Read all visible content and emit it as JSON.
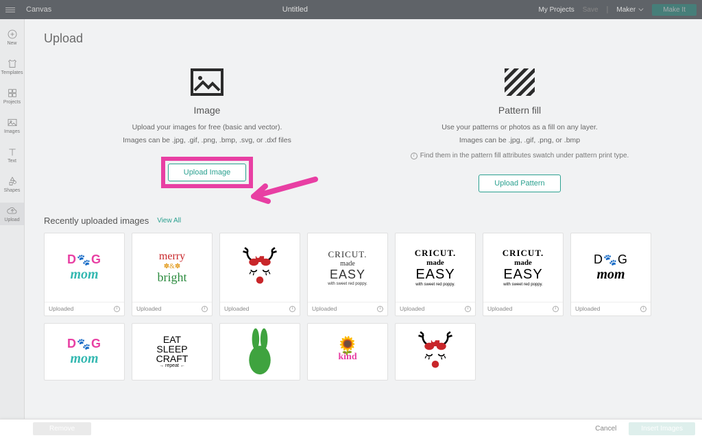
{
  "topbar": {
    "canvas_label": "Canvas",
    "title": "Untitled",
    "my_projects": "My Projects",
    "save": "Save",
    "maker": "Maker",
    "make_btn": "Make It"
  },
  "sidebar": {
    "items": [
      {
        "label": "New"
      },
      {
        "label": "Templates"
      },
      {
        "label": "Projects"
      },
      {
        "label": "Images"
      },
      {
        "label": "Text"
      },
      {
        "label": "Shapes"
      },
      {
        "label": "Upload"
      }
    ]
  },
  "page": {
    "title": "Upload"
  },
  "image_panel": {
    "heading": "Image",
    "line1": "Upload your images for free (basic and vector).",
    "line2": "Images can be .jpg, .gif, .png, .bmp, .svg, or .dxf files",
    "button": "Upload Image"
  },
  "pattern_panel": {
    "heading": "Pattern fill",
    "line1": "Use your patterns or photos as a fill on any layer.",
    "line2": "Images can be .jpg, .gif, .png, or .bmp",
    "line3": "Find them in the pattern fill attributes swatch under pattern print type.",
    "button": "Upload Pattern"
  },
  "recent": {
    "heading": "Recently uploaded images",
    "view_all": "View All",
    "status_label": "Uploaded",
    "row1": [
      {
        "art": "dogmom-color"
      },
      {
        "art": "merry-bright"
      },
      {
        "art": "reindeer"
      },
      {
        "art": "cricut-easy-outline"
      },
      {
        "art": "cricut-easy-black"
      },
      {
        "art": "cricut-easy-black"
      },
      {
        "art": "dogmom-black"
      }
    ],
    "row2": [
      {
        "art": "dogmom-color"
      },
      {
        "art": "eat-sleep-craft"
      },
      {
        "art": "bunny"
      },
      {
        "art": "sunflower-kind"
      },
      {
        "art": "reindeer"
      }
    ]
  },
  "bottombar": {
    "remove": "Remove",
    "cancel": "Cancel",
    "insert": "Insert Images"
  },
  "colors": {
    "accent": "#2aa08f",
    "highlight": "#e83fa3"
  }
}
